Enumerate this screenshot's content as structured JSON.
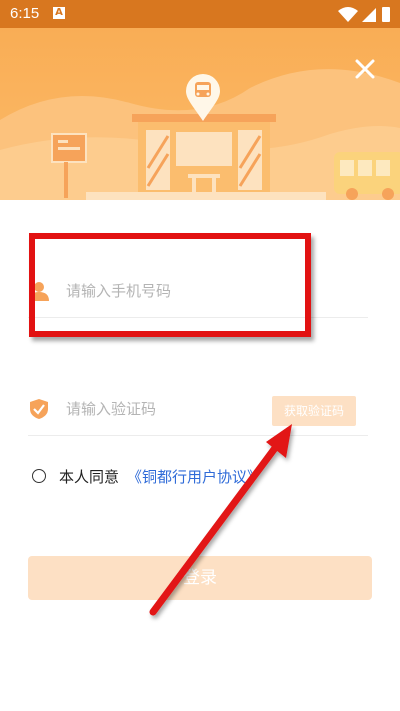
{
  "status_bar": {
    "time": "6:15",
    "notification_letter": "A"
  },
  "colors": {
    "brand_orange": "#fbb25e",
    "status_bar": "#d8771f",
    "disabled_button": "#fde0c4",
    "link": "#2f6bd8",
    "annotation_red": "#e21212"
  },
  "header": {
    "close_icon": "close-icon",
    "logo_icon": "bus-location-pin-icon"
  },
  "form": {
    "phone_placeholder": "请输入手机号码",
    "phone_icon": "user-icon",
    "code_placeholder": "请输入验证码",
    "code_icon": "shield-check-icon",
    "get_code_label": "获取验证码"
  },
  "agreement": {
    "prefix": "本人同意",
    "link": "《铜都行用户协议》"
  },
  "login_label": "登录",
  "annotation": {
    "box": "highlight-box",
    "arrow": "red-arrow"
  }
}
